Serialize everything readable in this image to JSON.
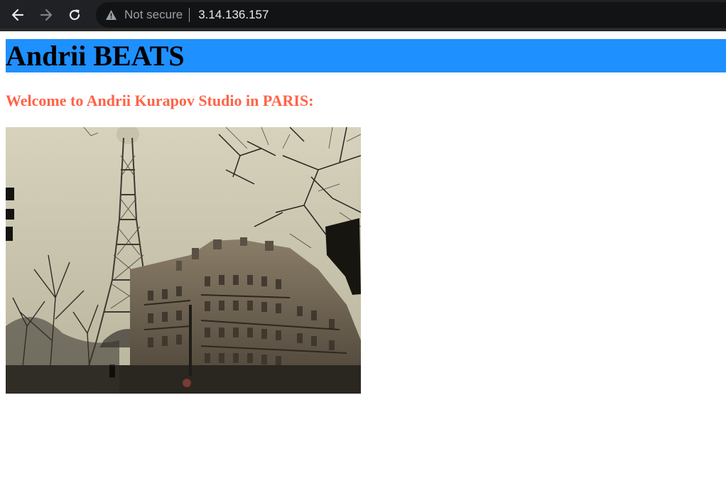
{
  "browser": {
    "security_label": "Not secure",
    "url": "3.14.136.157",
    "icons": [
      "back-arrow-icon",
      "forward-arrow-icon",
      "reload-icon",
      "warning-icon"
    ]
  },
  "page": {
    "title": "Andrii BEATS",
    "welcome": "Welcome to Andrii Kurapov Studio in PARIS:",
    "colors": {
      "header_bg": "#1e90ff",
      "welcome_text": "#ff6347"
    },
    "image": {
      "subject": "eiffel-tower-street-photo"
    }
  }
}
